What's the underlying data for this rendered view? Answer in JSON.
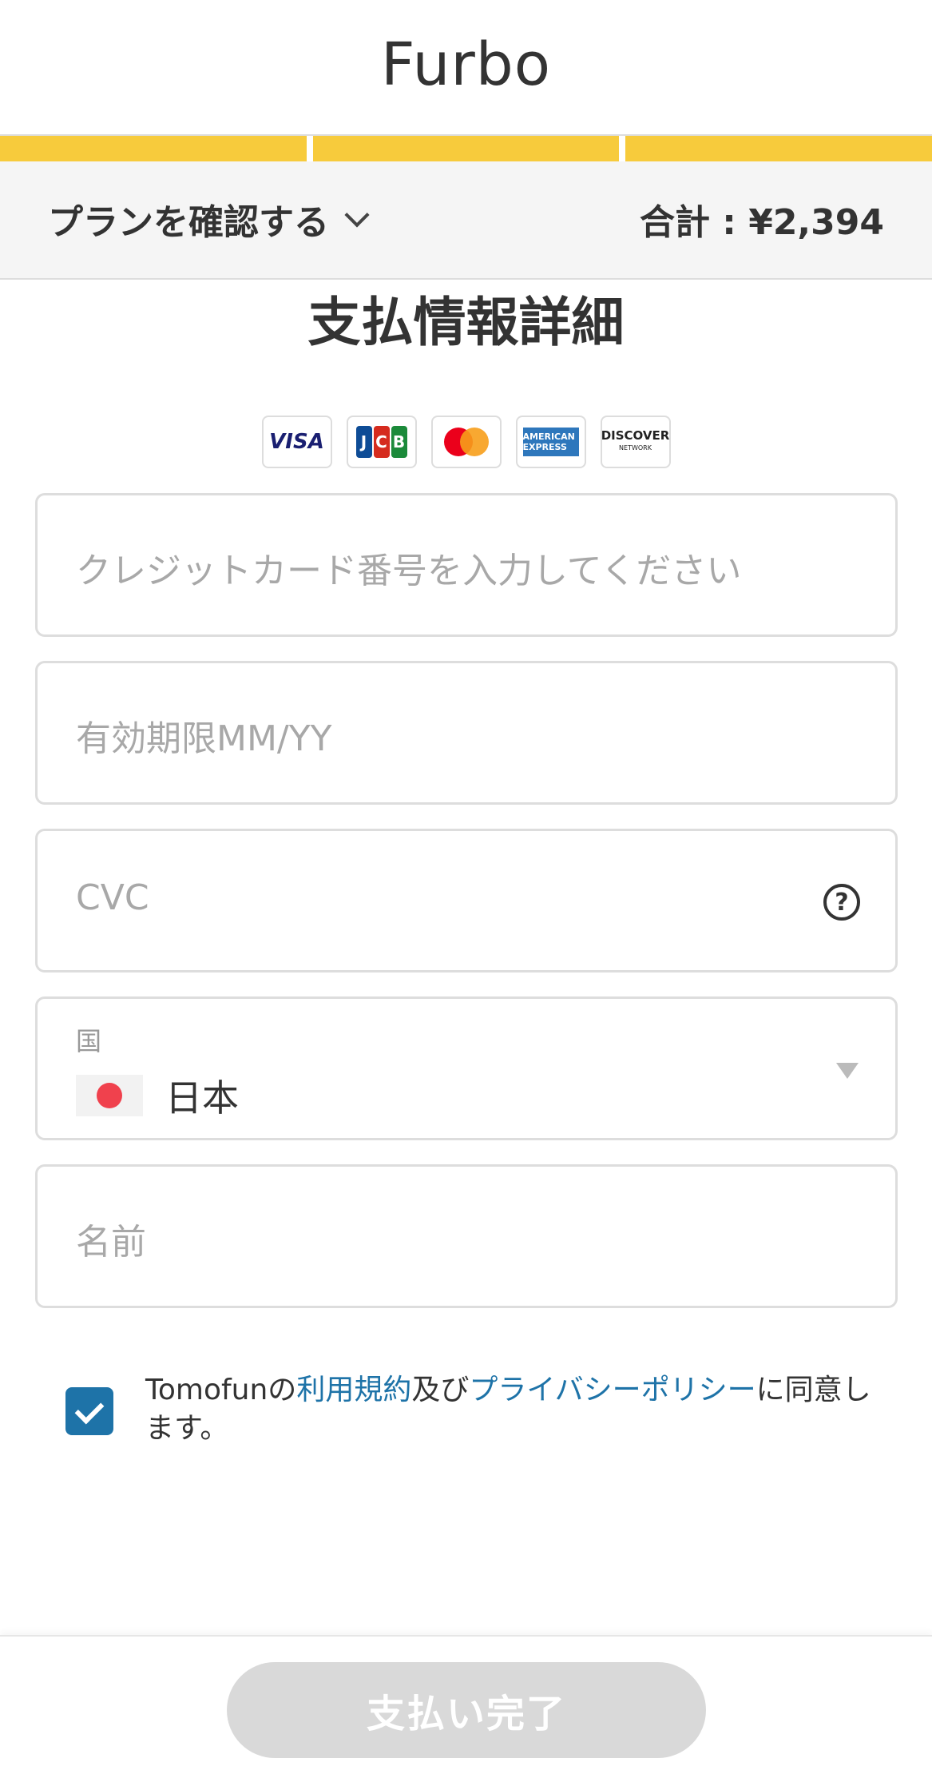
{
  "brand": {
    "logo_text": "Furbo"
  },
  "progress": {
    "steps": 3,
    "completed": 3,
    "color": "#f7cb3c"
  },
  "plan_bar": {
    "toggle_label": "プランを確認する",
    "total_text": "合計 : ¥2,394"
  },
  "page_title": "支払情報詳細",
  "card_brands": [
    {
      "name": "VISA",
      "icon": "visa-logo"
    },
    {
      "name": "JCB",
      "icon": "jcb-logo"
    },
    {
      "name": "Mastercard",
      "icon": "mastercard-logo"
    },
    {
      "name": "AMERICAN EXPRESS",
      "icon": "amex-logo"
    },
    {
      "name": "DISCOVER",
      "sub": "NETWORK",
      "icon": "discover-logo"
    }
  ],
  "form": {
    "card_number_placeholder": "クレジットカード番号を入力してください",
    "expiry_placeholder": "有効期限MM/YY",
    "cvc_placeholder": "CVC",
    "cvc_help": "?",
    "country_label": "国",
    "country_value": "日本",
    "name_placeholder": "名前"
  },
  "agreement": {
    "checked": true,
    "prefix": "Tomofunの",
    "terms_link": "利用規約",
    "middle": "及び",
    "privacy_link": "プライバシーポリシー",
    "suffix": "に同意します。"
  },
  "footer": {
    "pay_button_label": "支払い完了"
  },
  "colors": {
    "accent": "#1e73a8",
    "progress": "#f7cb3c",
    "button_disabled": "#d9d9d9"
  }
}
